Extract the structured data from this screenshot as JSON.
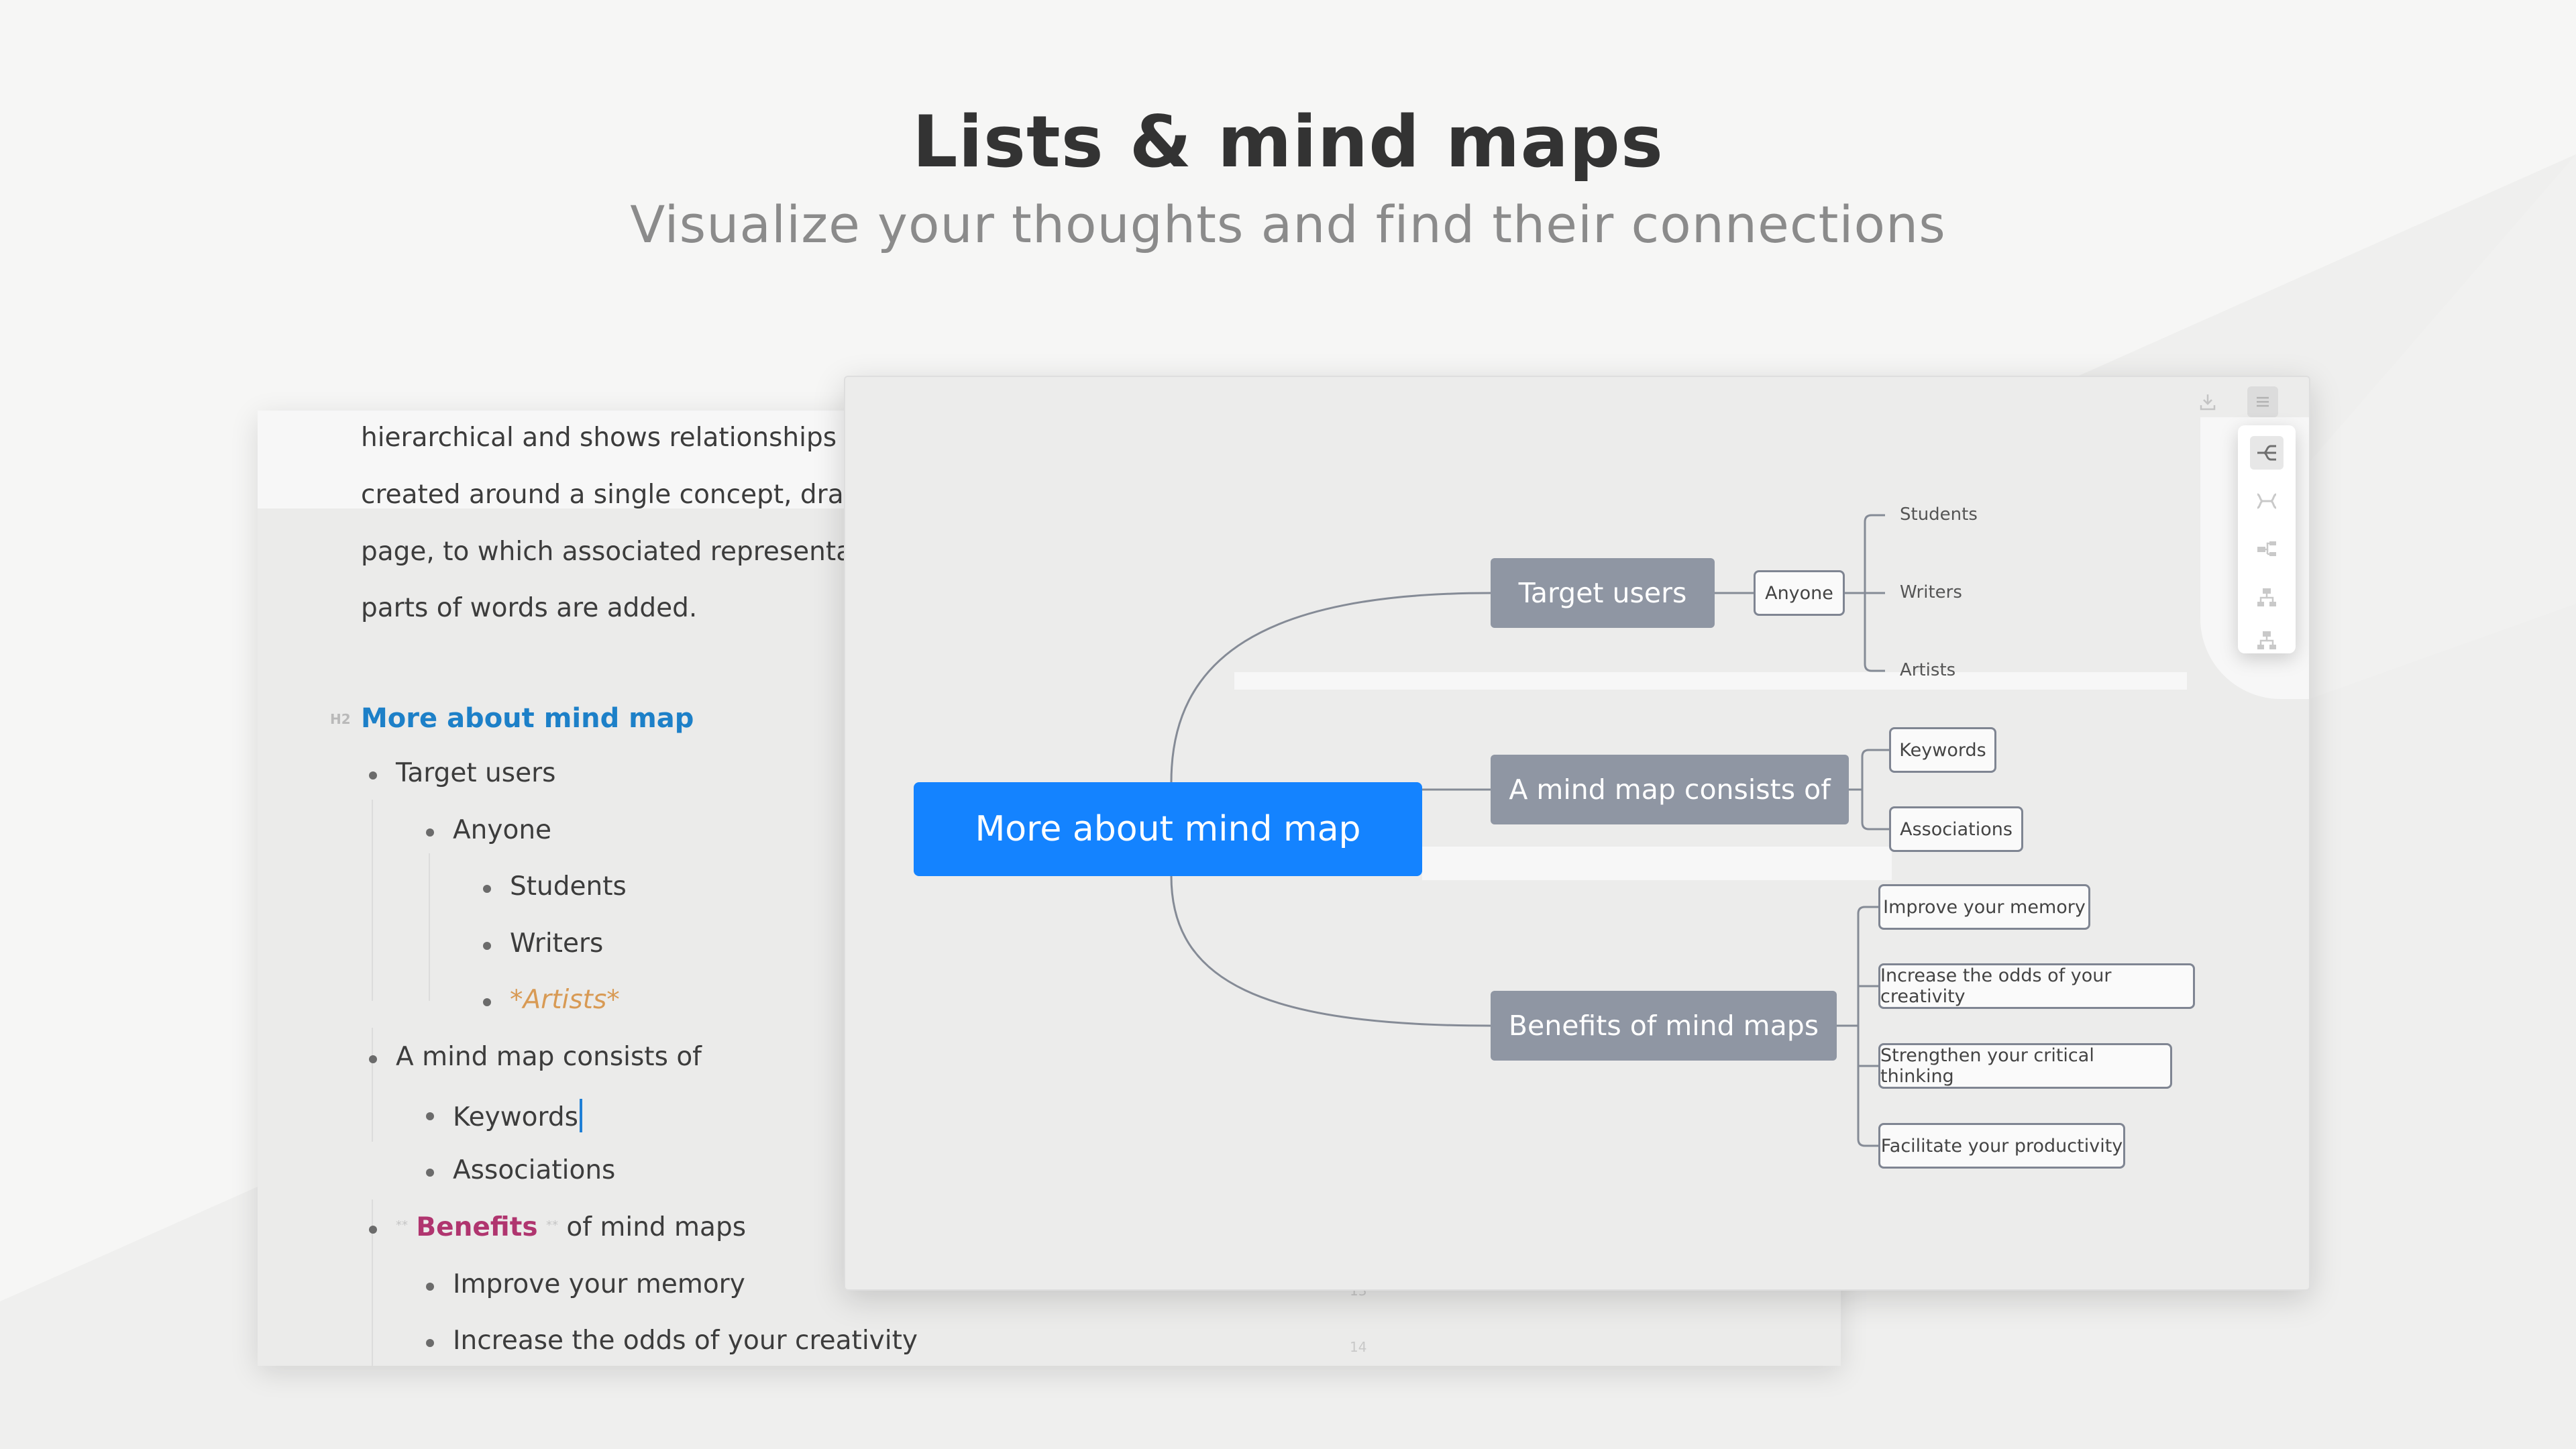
{
  "hero": {
    "title": "Lists & mind maps",
    "subtitle": "Visualize your thoughts and find their connections"
  },
  "editor": {
    "paragraph_lines": [
      "hierarchical and shows relationships amor",
      "created around a single concept, drawn as",
      "page, to which associated representations",
      "parts of words are added."
    ],
    "heading_marker": "H2",
    "heading": "More about mind map",
    "list": {
      "target_users": "Target users",
      "anyone": "Anyone",
      "students": "Students",
      "writers": "Writers",
      "artists": "*Artists*",
      "consists_of": "A mind map consists of",
      "keywords": "Keywords",
      "associations": "Associations",
      "benefits_marker_before": "**",
      "benefits_bold": "Benefits",
      "benefits_marker_after": "**",
      "benefits_rest": "of mind maps",
      "improve_memory": "Improve your memory",
      "increase_creativity": "Increase the odds of your creativity"
    },
    "line_numbers": [
      "13",
      "14"
    ]
  },
  "mindmap": {
    "root": "More about mind map",
    "branches": [
      {
        "label": "Target users",
        "child": "Anyone",
        "leaves": [
          "Students",
          "Writers",
          "Artists"
        ]
      },
      {
        "label": "A mind map consists of",
        "children": [
          "Keywords",
          "Associations"
        ]
      },
      {
        "label": "Benefits of mind maps",
        "children": [
          "Improve your memory",
          "Increase the odds of your creativity",
          "Strengthen your critical thinking",
          "Facilitate your productivity"
        ]
      }
    ],
    "colors": {
      "root": "#1483ff",
      "branch": "#8f96a3",
      "connector": "#858b96"
    },
    "toolbar_icons": [
      "mindmap-right-icon",
      "mindmap-both-icon",
      "tree-right-icon",
      "org-chart-icon",
      "org-chart-alt-icon"
    ],
    "top_icons": [
      "download-icon",
      "menu-icon"
    ]
  }
}
